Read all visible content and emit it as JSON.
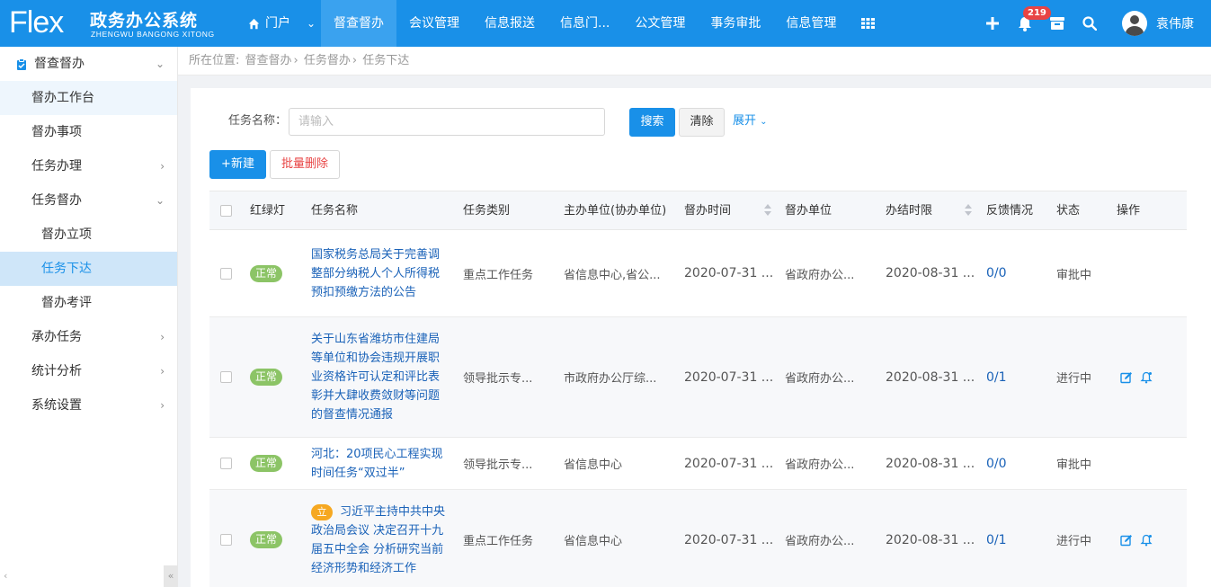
{
  "app": {
    "logo_mark": "Flex",
    "title": "政务办公系统",
    "subtitle": "ZHENGWU BANGONG XITONG"
  },
  "nav": {
    "home": "门户",
    "items": [
      "督查督办",
      "会议管理",
      "信息报送",
      "信息门...",
      "公文管理",
      "事务审批",
      "信息管理"
    ]
  },
  "header": {
    "badge_count": "219",
    "user_name": "袁伟康"
  },
  "sidebar": {
    "section": "督查督办",
    "items": [
      {
        "label": "督办工作台"
      },
      {
        "label": "督办事项"
      },
      {
        "label": "任务办理"
      },
      {
        "label": "任务督办"
      },
      {
        "label": "督办立项"
      },
      {
        "label": "任务下达"
      },
      {
        "label": "督办考评"
      },
      {
        "label": "承办任务"
      },
      {
        "label": "统计分析"
      },
      {
        "label": "系统设置"
      }
    ]
  },
  "breadcrumb": {
    "prefix": "所在位置:",
    "path": [
      "督查督办",
      "任务督办",
      "任务下达"
    ]
  },
  "search": {
    "label": "任务名称：",
    "placeholder": "请输入",
    "search_btn": "搜索",
    "clear_btn": "清除",
    "expand": "展开"
  },
  "toolbar": {
    "new_btn": "+新建",
    "batch_delete_btn": "批量删除"
  },
  "table": {
    "columns": [
      "红绿灯",
      "任务名称",
      "任务类别",
      "主办单位(协办单位)",
      "督办时间",
      "督办单位",
      "办结时限",
      "反馈情况",
      "状态",
      "操作"
    ],
    "rows": [
      {
        "light": "正常",
        "tag": "",
        "name": "国家税务总局关于完善调整部分纳税人个人所得税预扣预缴方法的公告",
        "category": "重点工作任务",
        "unit": "省信息中心,省公...",
        "supervise_time": "2020-07-31 ...",
        "supervise_unit": "省政府办公...",
        "deadline": "2020-08-31 ...",
        "feedback": "0/0",
        "status": "审批中",
        "actions": []
      },
      {
        "light": "正常",
        "tag": "",
        "name": "关于山东省潍坊市住建局等单位和协会违规开展职业资格许可认定和评比表彰并大肆收费敛财等问题的督查情况通报",
        "category": "领导批示专...",
        "unit": "市政府办公厅综...",
        "supervise_time": "2020-07-31 ...",
        "supervise_unit": "省政府办公...",
        "deadline": "2020-08-31 ...",
        "feedback": "0/1",
        "status": "进行中",
        "actions": [
          "edit-icon",
          "bell-icon"
        ]
      },
      {
        "light": "正常",
        "tag": "",
        "name": "河北：20项民心工程实现时间任务“双过半”",
        "category": "领导批示专...",
        "unit": "省信息中心",
        "supervise_time": "2020-07-31 ...",
        "supervise_unit": "省政府办公...",
        "deadline": "2020-08-31 ...",
        "feedback": "0/0",
        "status": "审批中",
        "actions": []
      },
      {
        "light": "正常",
        "tag": "立",
        "name": "习近平主持中共中央政治局会议 决定召开十九届五中全会 分析研究当前经济形势和经济工作",
        "category": "重点工作任务",
        "unit": "省信息中心",
        "supervise_time": "2020-07-31 ...",
        "supervise_unit": "省政府办公...",
        "deadline": "2020-08-31 ...",
        "feedback": "0/1",
        "status": "进行中",
        "actions": [
          "edit-icon",
          "bell-icon"
        ]
      }
    ]
  },
  "colors": {
    "primary": "#1990e8",
    "ok_tag": "#8cc466",
    "li_tag": "#f6a821",
    "danger": "#e84444"
  }
}
